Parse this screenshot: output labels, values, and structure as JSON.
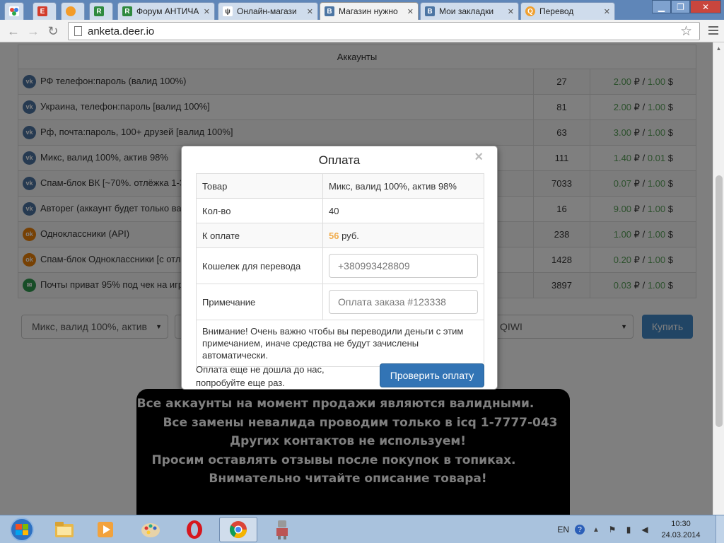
{
  "browser": {
    "tabs": [
      {
        "title": "",
        "favicon_color": "#ffffff",
        "favicon_text": ""
      },
      {
        "title": "",
        "favicon_color": "#d23c2c",
        "favicon_text": "E"
      },
      {
        "title": "",
        "favicon_color": "#f39c2a",
        "favicon_text": ""
      },
      {
        "title": "",
        "favicon_color": "#2f8a3f",
        "favicon_text": "R"
      },
      {
        "title": "Форум АНТИЧА",
        "favicon_color": "#2f8a3f",
        "favicon_text": "R"
      },
      {
        "title": "Онлайн-магази",
        "favicon_color": "#ffffff",
        "favicon_text": "ψ"
      },
      {
        "title": "Магазин нужно",
        "favicon_color": "#4c75a3",
        "favicon_text": "B"
      },
      {
        "title": "Мои закладки",
        "favicon_color": "#4c75a3",
        "favicon_text": "B"
      },
      {
        "title": "Перевод",
        "favicon_color": "#f0a030",
        "favicon_text": "Q"
      }
    ],
    "url": "anketa.deer.io"
  },
  "table": {
    "section_title": "Аккаунты",
    "rows": [
      {
        "name": "РФ телефон:пароль (валид 100%)",
        "icon": "vk-icon",
        "icon_color": "#4c75a3",
        "icon_glyph": "vk",
        "qty": "27",
        "rub": "2.00",
        "usd": "1.00"
      },
      {
        "name": "Украина, телефон:пароль [валид 100%]",
        "icon": "vk-icon",
        "icon_color": "#4c75a3",
        "icon_glyph": "vk",
        "qty": "81",
        "rub": "2.00",
        "usd": "1.00"
      },
      {
        "name": "Рф, почта:пароль, 100+ друзей [валид 100%]",
        "icon": "vk-icon",
        "icon_color": "#4c75a3",
        "icon_glyph": "vk",
        "qty": "63",
        "rub": "3.00",
        "usd": "1.00"
      },
      {
        "name": "Микс, валид 100%, актив 98%",
        "icon": "vk-icon",
        "icon_color": "#4c75a3",
        "icon_glyph": "vk",
        "qty": "111",
        "rub": "1.40",
        "usd": "0.01"
      },
      {
        "name": "Спам-блок ВК [~70%. отлёжка 1-3",
        "icon": "vk-icon",
        "icon_color": "#4c75a3",
        "icon_glyph": "vk",
        "qty": "7033",
        "rub": "0.07",
        "usd": "1.00"
      },
      {
        "name": "Авторег (аккаунт будет только ва",
        "icon": "vk-icon",
        "icon_color": "#4c75a3",
        "icon_glyph": "vk",
        "qty": "16",
        "rub": "9.00",
        "usd": "1.00"
      },
      {
        "name": "Одноклассники (API)",
        "icon": "odnoklassniki-icon",
        "icon_color": "#ee8208",
        "icon_glyph": "ok",
        "qty": "238",
        "rub": "1.00",
        "usd": "1.00"
      },
      {
        "name": "Спам-блок Одноклассники [с отл",
        "icon": "odnoklassniki-icon",
        "icon_color": "#ee8208",
        "icon_glyph": "ok",
        "qty": "1428",
        "rub": "0.20",
        "usd": "1.00"
      },
      {
        "name": "Почты приват 95% под чек на игр",
        "icon": "mail-icon",
        "icon_color": "#2e9b4e",
        "icon_glyph": "✉",
        "qty": "3897",
        "rub": "0.03",
        "usd": "1.00"
      }
    ],
    "ruble_sign": "₽",
    "slash": "/",
    "dollar_sign": "$"
  },
  "order_form": {
    "product_select": "Микс, валид 100%, актив",
    "payment_select": "QIWI",
    "buy_label": "Купить"
  },
  "notice_lines": [
    "Все аккаунты на момент продажи являются валидными.",
    "Все замены невалида проводим только в  icq 1-7777-043",
    "Других контактов не используем!",
    "Просим оставлять отзывы после покупок в топиках.",
    "Внимательно читайте описание товара!"
  ],
  "modal": {
    "title": "Оплата",
    "close": "×",
    "product_label": "Товар",
    "product_value": "Микс, валид 100%, актив 98%",
    "qty_label": "Кол-во",
    "qty_value": "40",
    "total_label": "К оплате",
    "total_amount": "56",
    "total_currency": "руб.",
    "wallet_label": "Кошелек для перевода",
    "wallet_value": "+380993428809",
    "note_label": "Примечание",
    "note_value": "Оплата заказа #123338",
    "warning": "Внимание! Очень важно чтобы вы переводили деньги с этим примечанием, иначе средства не будут зачислены автоматически.",
    "pending_line1": "Оплата еще не дошла до нас,",
    "pending_line2": "попробуйте еще раз.",
    "check_button": "Проверить оплату"
  },
  "taskbar": {
    "apps": [
      "explorer-icon",
      "media-player-icon",
      "paint-icon",
      "opera-icon",
      "chrome-icon",
      "robot-app-icon"
    ],
    "lang": "EN",
    "time": "10:30",
    "date": "24.03.2014"
  }
}
